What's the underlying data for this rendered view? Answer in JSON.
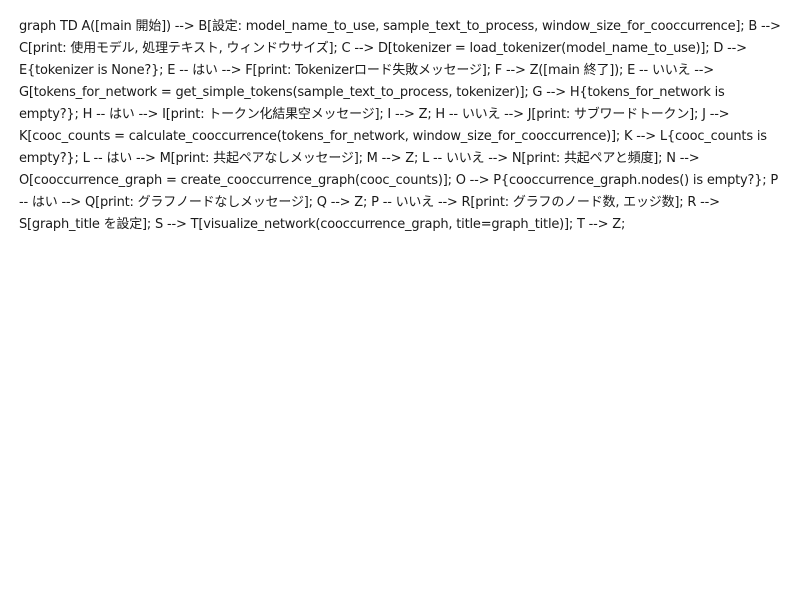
{
  "page": {
    "text": "graph TD A([main 開始]) --> B[設定: model_name_to_use, sample_text_to_process, window_size_for_cooccurrence]; B --> C[print: 使用モデル, 処理テキスト, ウィンドウサイズ]; C --> D[tokenizer = load_tokenizer(model_name_to_use)]; D --> E{tokenizer is None?}; E -- はい --> F[print: Tokenizerロード失敗メッセージ]; F --> Z([main 終了]); E -- いいえ --> G[tokens_for_network = get_simple_tokens(sample_text_to_process, tokenizer)]; G --> H{tokens_for_network is empty?}; H -- はい --> I[print: トークン化結果空メッセージ]; I --> Z; H -- いいえ --> J[print: サブワードトークン]; J --> K[cooc_counts = calculate_cooccurrence(tokens_for_network, window_size_for_cooccurrence)]; K --> L{cooc_counts is empty?}; L -- はい --> M[print: 共起ペアなしメッセージ]; M --> Z; L -- いいえ --> N[print: 共起ペアと頻度]; N --> O[cooccurrence_graph = create_cooccurrence_graph(cooc_counts)]; O --> P{cooccurrence_graph.nodes() is empty?}; P -- はい --> Q[print: グラフノードなしメッセージ]; Q --> Z; P -- いいえ --> R[print: グラフのノード数, エッジ数]; R --> S[graph_title を設定]; S --> T[visualize_network(cooccurrence_graph, title=graph_title)]; T --> Z;"
  }
}
